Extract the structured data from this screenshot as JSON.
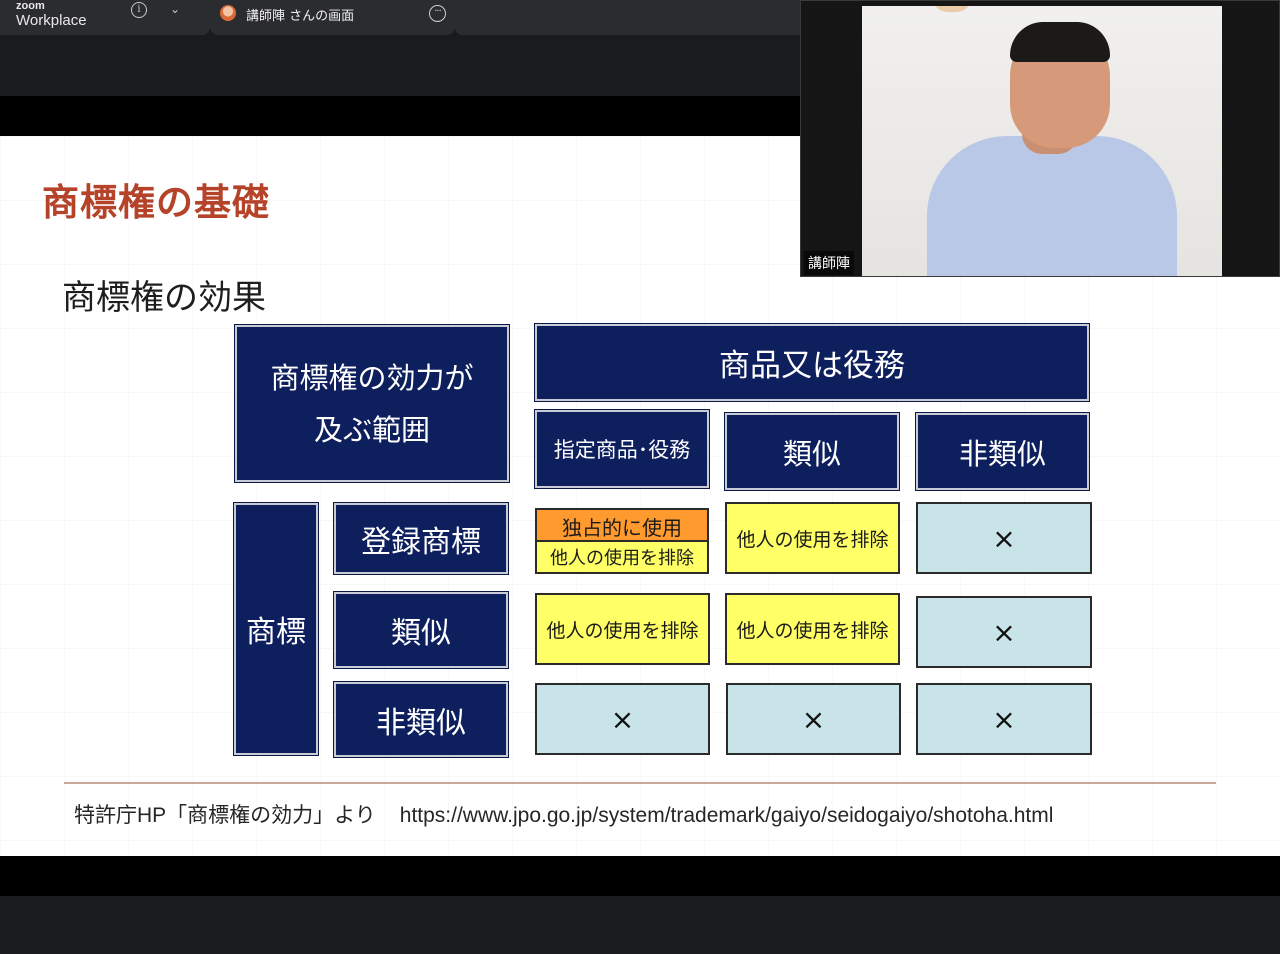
{
  "app": {
    "brand_small": "zoom",
    "brand_large": "Workplace",
    "info_glyph": "i",
    "chevron_glyph": "⌄",
    "share_tab_label": "講師陣 さんの画面",
    "more_glyph": "···"
  },
  "video": {
    "participant_name": "講師陣"
  },
  "slide": {
    "title": "商標権の基礎",
    "subtitle": "商標権の効果",
    "table": {
      "scope_header_line1": "商標権の効力が",
      "scope_header_line2": "及ぶ範囲",
      "goods_header": "商品又は役務",
      "col_designated": "指定商品･役務",
      "col_similar": "類似",
      "col_dissimilar": "非類似",
      "mark_header": "商標",
      "row_registered": "登録商標",
      "row_similar": "類似",
      "row_dissimilar": "非類似",
      "exclusive_use": "独占的に使用",
      "exclude_others": "他人の使用を排除",
      "cross": "×"
    },
    "source_prefix": "特許庁HP「商標権の効力」より",
    "source_url": "https://www.jpo.go.jp/system/trademark/gaiyo/seidogaiyo/shotoha.html"
  },
  "colors": {
    "title": "#b5432a",
    "navy": "#0e1f5e",
    "yellow": "#ffff66",
    "orange": "#ff9a2e",
    "cyan": "#c8e4e8"
  }
}
